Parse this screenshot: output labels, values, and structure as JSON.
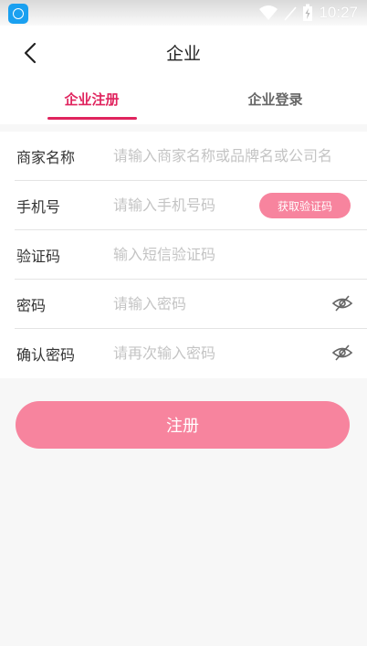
{
  "status_bar": {
    "time": "10:27"
  },
  "header": {
    "title": "企业"
  },
  "tabs": [
    {
      "label": "企业注册",
      "active": true
    },
    {
      "label": "企业登录",
      "active": false
    }
  ],
  "form": {
    "merchant_name": {
      "label": "商家名称",
      "placeholder": "请输入商家名称或品牌名或公司名"
    },
    "phone": {
      "label": "手机号",
      "placeholder": "请输入手机号码",
      "code_button": "获取验证码"
    },
    "verify_code": {
      "label": "验证码",
      "placeholder": "输入短信验证码"
    },
    "password": {
      "label": "密码",
      "placeholder": "请输入密码"
    },
    "confirm_password": {
      "label": "确认密码",
      "placeholder": "请再次输入密码"
    }
  },
  "submit_label": "注册",
  "colors": {
    "accent": "#e0245e",
    "button": "#f7849e",
    "background": "#f7f7f7"
  }
}
